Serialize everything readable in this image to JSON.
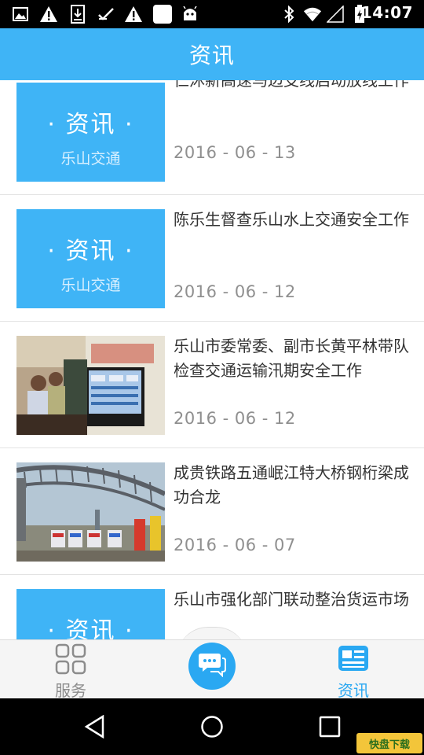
{
  "status_bar": {
    "time": "14:07",
    "left_icons": [
      "image-icon",
      "warning-icon",
      "download-icon",
      "check-icon",
      "warning-icon",
      "square-icon",
      "android-icon"
    ],
    "right_icons": [
      "bluetooth-icon",
      "wifi-icon",
      "signal-icon",
      "battery-icon"
    ]
  },
  "header": {
    "title": "资讯"
  },
  "placeholder": {
    "main": "· 资讯 ·",
    "sub": "乐山交通"
  },
  "news": [
    {
      "title": "仁沐新高速马边支线启动放线工作",
      "date": "2016 - 06 - 13",
      "thumb": "placeholder"
    },
    {
      "title": "陈乐生督查乐山水上交通安全工作",
      "date": "2016 - 06 - 12",
      "thumb": "placeholder"
    },
    {
      "title": "乐山市委常委、副市长黄平林带队检查交通运输汛期安全工作",
      "date": "2016 - 06 - 12",
      "thumb": "photo-monitoring-room"
    },
    {
      "title": "成贵铁路五通岷江特大桥钢桁梁成功合龙",
      "date": "2016 - 06 - 07",
      "thumb": "photo-bridge"
    },
    {
      "title": "乐山市强化部门联动整治货运市场",
      "date": "",
      "thumb": "placeholder"
    }
  ],
  "bottom_nav": {
    "tabs": [
      {
        "label": "服务",
        "icon": "grid-icon",
        "active": false
      },
      {
        "label": "资讯",
        "icon": "news-icon",
        "active": true
      }
    ],
    "center_icon": "chat-icon"
  },
  "colors": {
    "primary": "#3fb4f6",
    "active_tab": "#2aa8f2",
    "inactive_tab": "#8c8c8c"
  },
  "watermark": "快盘下载"
}
